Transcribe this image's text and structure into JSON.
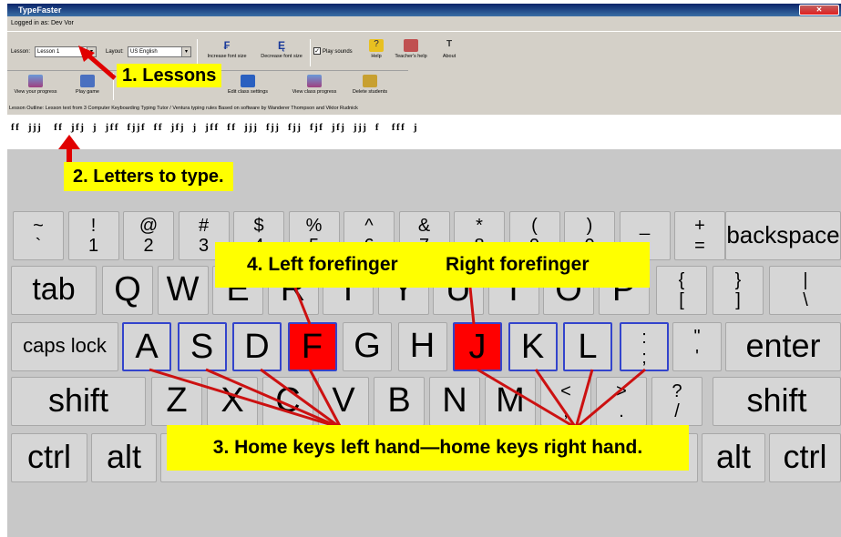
{
  "window": {
    "title": "TypeFaster"
  },
  "menu": {
    "text": "Logged in as: Dev Vor"
  },
  "toolbar": {
    "lesson_label": "Lesson:",
    "lesson_value": "Lesson 1",
    "layout_label": "Layout:",
    "layout_value": "US English",
    "increase_font": "Increase font size",
    "decrease_font": "Decrease font size",
    "play_sounds_label": "Play sounds",
    "help": "Help",
    "teachers_help": "Teacher's help",
    "about": "About",
    "view_progress": "View your progress",
    "play_game": "Play game",
    "edit_class_settings": "Edit class settings",
    "view_class_progress": "View class progress",
    "delete_students": "Delete students"
  },
  "status_line": "Lesson Outline: Lesson text from 3 Computer Keyboarding Typing Tutor / Ventura typing rules Based on software by Wanderer Thompson and Viktor Rudnick",
  "type_strip": "ff  jjj   ff  jfj  j  jff  fjjf  ff  jfj  j  jff  ff  jjj  fjj  fjj  fjf  jfj  jjj  f   fff  j",
  "keyboard": {
    "row1": [
      {
        "top": "~",
        "bottom": "`"
      },
      {
        "top": "!",
        "bottom": "1"
      },
      {
        "top": "@",
        "bottom": "2"
      },
      {
        "top": "#",
        "bottom": "3"
      },
      {
        "top": "$",
        "bottom": "4"
      },
      {
        "top": "%",
        "bottom": "5"
      },
      {
        "top": "^",
        "bottom": "6"
      },
      {
        "top": "&",
        "bottom": "7"
      },
      {
        "top": "*",
        "bottom": "8"
      },
      {
        "top": "(",
        "bottom": "9"
      },
      {
        "top": ")",
        "bottom": "0"
      },
      {
        "top": "_",
        "bottom": "-"
      },
      {
        "top": "+",
        "bottom": "="
      }
    ],
    "backspace": "backspace",
    "tab": "tab",
    "row2": [
      "Q",
      "W",
      "E",
      "R",
      "T",
      "Y",
      "U",
      "I",
      "O",
      "P"
    ],
    "row2_extra": [
      {
        "top": "{",
        "bottom": "["
      },
      {
        "top": "}",
        "bottom": "]"
      },
      {
        "top": "|",
        "bottom": "\\"
      }
    ],
    "caps_lock": "caps lock",
    "row3": [
      "A",
      "S",
      "D",
      "F",
      "G",
      "H",
      "J",
      "K",
      "L"
    ],
    "row3_extra": [
      {
        "top": ":",
        "bottom": ";"
      },
      {
        "top": "\"",
        "bottom": "'"
      }
    ],
    "enter": "enter",
    "shift_left": "shift",
    "row4": [
      "Z",
      "X",
      "C",
      "V",
      "B",
      "N",
      "M"
    ],
    "row4_extra": [
      {
        "top": "<",
        "bottom": ","
      },
      {
        "top": ">",
        "bottom": "."
      },
      {
        "top": "?",
        "bottom": "/"
      }
    ],
    "shift_right": "shift",
    "ctrl_left": "ctrl",
    "alt_left": "alt",
    "alt_right": "alt",
    "ctrl_right": "ctrl",
    "home_highlight_color": "#ff0000",
    "home_outline_color": "#3344cc"
  },
  "annotations": {
    "lessons": "1. Lessons",
    "letters": "2. Letters to type.",
    "left_forefinger": "4. Left forefinger",
    "right_forefinger": "Right forefinger",
    "home_keys": "3. Home keys left hand—home keys right hand.",
    "callout_color": "#ffff00",
    "arrow_color": "#e00000",
    "line_color": "#cc1111"
  }
}
